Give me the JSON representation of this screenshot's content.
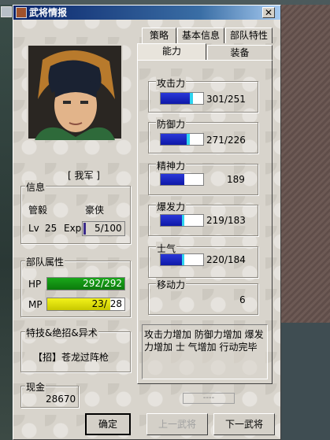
{
  "window": {
    "title": "武将情报",
    "close_glyph": "✕"
  },
  "tabs": {
    "row1": [
      "策略",
      "基本信息",
      "部队特性"
    ],
    "row2": [
      "能力",
      "装备"
    ],
    "active": "能力"
  },
  "officer": {
    "faction": "[ 我军 ]",
    "info_header": "信息",
    "name": "管毅",
    "trait": "豪侠",
    "level_label": "Lv",
    "level": "25",
    "exp_label": "Exp",
    "exp": "5/100"
  },
  "troops": {
    "header": "部队属性",
    "hp_label": "HP",
    "hp": "292/292",
    "hp_fraction": 1.0,
    "mp_label": "MP",
    "mp": "23/ 28",
    "mp_fraction": 0.82
  },
  "skills": {
    "header": "特技&绝招&异术",
    "skill": "【招】苍龙过阵枪"
  },
  "gold": {
    "header": "现金",
    "value": "28670"
  },
  "stats": [
    {
      "label": "攻击力",
      "value": "301/251",
      "base_fraction": 0.68,
      "bonus_fraction": 0.08
    },
    {
      "label": "防御力",
      "value": "271/226",
      "base_fraction": 0.62,
      "bonus_fraction": 0.08
    },
    {
      "label": "精神力",
      "value": "189",
      "base_fraction": 0.55,
      "bonus_fraction": 0.0
    },
    {
      "label": "爆发力",
      "value": "219/183",
      "base_fraction": 0.5,
      "bonus_fraction": 0.06
    },
    {
      "label": "士气",
      "value": "220/184",
      "base_fraction": 0.5,
      "bonus_fraction": 0.06
    }
  ],
  "move": {
    "label": "移动力",
    "value": "6"
  },
  "description": "攻击力增加 防御力增加 爆发力增加 士 气增加  行动完毕",
  "slot_text": "----",
  "buttons": {
    "ok": "确定",
    "prev": "上一武将",
    "next": "下一武将"
  },
  "colors": {
    "hp_green": "#0c8c0c",
    "mp_yellow": "#e6e600",
    "stat_blue": "#0e18a8",
    "stat_cyan": "#2ed4f0",
    "title_blue": "#0a246a"
  }
}
